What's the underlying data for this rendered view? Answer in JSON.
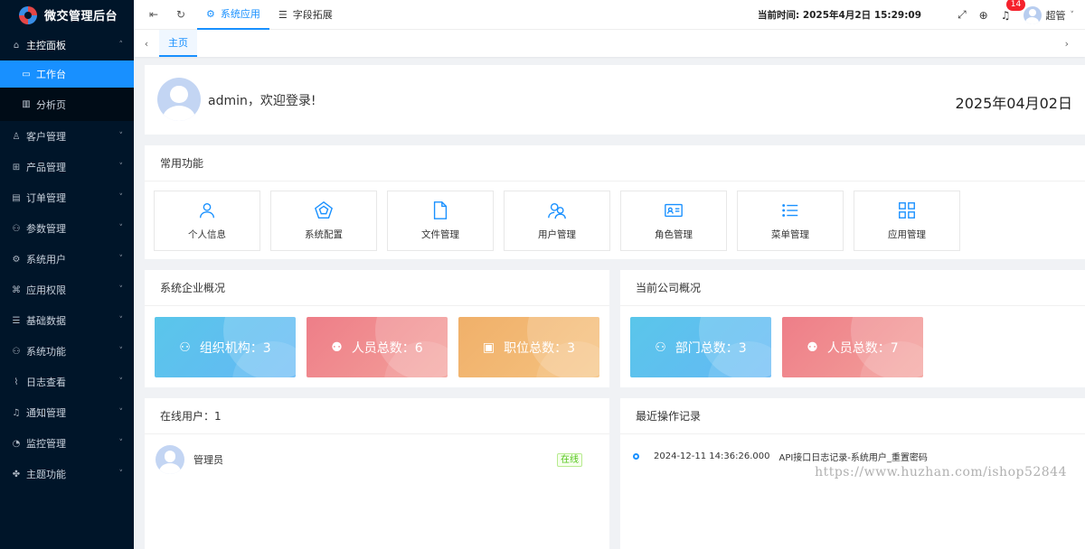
{
  "brand": {
    "title": "微交管理后台"
  },
  "sidebar": {
    "items": [
      {
        "label": "主控面板",
        "icon": "home-icon",
        "glyph": "⌂",
        "open": true,
        "children": [
          {
            "label": "工作台",
            "icon": "monitor-icon",
            "glyph": "▭",
            "active": true
          },
          {
            "label": "分析页",
            "icon": "bar-chart-icon",
            "glyph": "▥",
            "active": false
          }
        ]
      },
      {
        "label": "客户管理",
        "icon": "user-icon",
        "glyph": "♙"
      },
      {
        "label": "产品管理",
        "icon": "grid-icon",
        "glyph": "⊞"
      },
      {
        "label": "订单管理",
        "icon": "document-icon",
        "glyph": "▤"
      },
      {
        "label": "参数管理",
        "icon": "sitemap-icon",
        "glyph": "⚇"
      },
      {
        "label": "系统用户",
        "icon": "gear-icon",
        "glyph": "⚙"
      },
      {
        "label": "应用权限",
        "icon": "code-icon",
        "glyph": "⌘"
      },
      {
        "label": "基础数据",
        "icon": "list-icon",
        "glyph": "☰"
      },
      {
        "label": "系统功能",
        "icon": "sitemap-icon",
        "glyph": "⚇"
      },
      {
        "label": "日志查看",
        "icon": "line-chart-icon",
        "glyph": "⌇"
      },
      {
        "label": "通知管理",
        "icon": "bell-icon",
        "glyph": "♫"
      },
      {
        "label": "监控管理",
        "icon": "dashboard-icon",
        "glyph": "◔"
      },
      {
        "label": "主题功能",
        "icon": "puzzle-icon",
        "glyph": "✤"
      }
    ]
  },
  "header": {
    "tabs": [
      {
        "label": "系统应用",
        "icon": "gear-icon",
        "glyph": "⚙",
        "active": true
      },
      {
        "label": "字段拓展",
        "icon": "list-icon",
        "glyph": "☰",
        "active": false
      }
    ],
    "time_label": "当前时间: 2025年4月2日 15:29:09",
    "notification_count": "14",
    "user_name": "超管"
  },
  "tabbar": {
    "page_tab": "主页"
  },
  "welcome": {
    "greeting": "admin，欢迎登录!",
    "date": "2025年04月02日"
  },
  "common_functions": {
    "title": "常用功能",
    "items": [
      {
        "label": "个人信息",
        "icon": "user-icon"
      },
      {
        "label": "系统配置",
        "icon": "pentagon-icon"
      },
      {
        "label": "文件管理",
        "icon": "file-icon"
      },
      {
        "label": "用户管理",
        "icon": "users-icon"
      },
      {
        "label": "角色管理",
        "icon": "id-card-icon"
      },
      {
        "label": "菜单管理",
        "icon": "list-icon"
      },
      {
        "label": "应用管理",
        "icon": "apps-icon"
      }
    ]
  },
  "system_overview": {
    "title": "系统企业概况",
    "stats": [
      {
        "label": "组织机构：3",
        "color": "#5ac6ea",
        "icon": "sitemap-icon"
      },
      {
        "label": "人员总数：6",
        "color": "#ee7e88",
        "icon": "users-icon"
      },
      {
        "label": "职位总数：3",
        "color": "#f0b06a",
        "icon": "badge-icon"
      }
    ]
  },
  "company_overview": {
    "title": "当前公司概况",
    "stats": [
      {
        "label": "部门总数：3",
        "color": "#5ac6ea",
        "icon": "sitemap-icon"
      },
      {
        "label": "人员总数：7",
        "color": "#ee7e88",
        "icon": "users-icon"
      }
    ]
  },
  "online_users": {
    "title": "在线用户：1",
    "users": [
      {
        "name": "管理员",
        "status": "在线"
      }
    ]
  },
  "recent_records": {
    "title": "最近操作记录",
    "items": [
      {
        "time": "2024-12-11 14:36:26.000",
        "text": "API接口日志记录-系统用户_重置密码"
      }
    ]
  },
  "watermark": "https://www.huzhan.com/ishop52844"
}
